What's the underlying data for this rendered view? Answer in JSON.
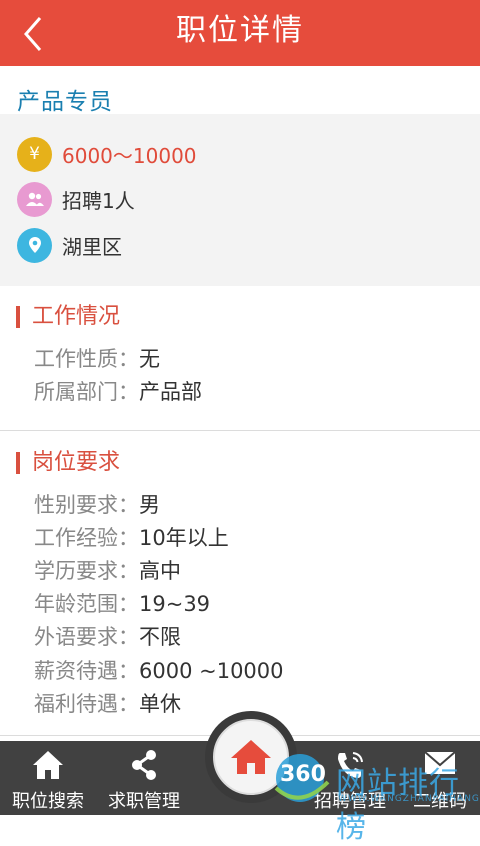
{
  "header": {
    "title": "职位详情",
    "back_icon": "chevron-left-icon"
  },
  "job": {
    "title": "产品专员"
  },
  "info": {
    "salary": "6000～10000",
    "salary_icon_glyph": "¥",
    "headcount": "招聘1人",
    "location": "湖里区",
    "colors": {
      "salary": "#e6b11a",
      "people": "#e89ad1",
      "location": "#3db6e0"
    }
  },
  "work": {
    "title": "工作情况",
    "items": [
      {
        "key": "工作性质：",
        "value": "无"
      },
      {
        "key": "所属部门：",
        "value": "产品部"
      }
    ]
  },
  "requirements": {
    "title": "岗位要求",
    "items": [
      {
        "key": "性别要求：",
        "value": "男"
      },
      {
        "key": "工作经验：",
        "value": "10年以上"
      },
      {
        "key": "学历要求：",
        "value": "高中"
      },
      {
        "key": "年龄范围：",
        "value": "19~39"
      },
      {
        "key": "外语要求：",
        "value": "不限"
      },
      {
        "key": "薪资待遇：",
        "value": "6000 ~10000"
      },
      {
        "key": "福利待遇：",
        "value": "单休"
      }
    ]
  },
  "tabbar": {
    "items": [
      {
        "label": "职位搜索",
        "icon": "home-icon"
      },
      {
        "label": "求职管理",
        "icon": "share-icon"
      },
      {
        "label": "招聘管理",
        "icon": "phone-icon"
      },
      {
        "label": "二维码",
        "icon": "mail-icon"
      }
    ],
    "center_icon": "home-icon"
  },
  "watermark": {
    "brand": "360",
    "text": "网站排行榜",
    "sub": "WWW.WANGZHANPAIHANG"
  },
  "accent": "#e64c3c"
}
